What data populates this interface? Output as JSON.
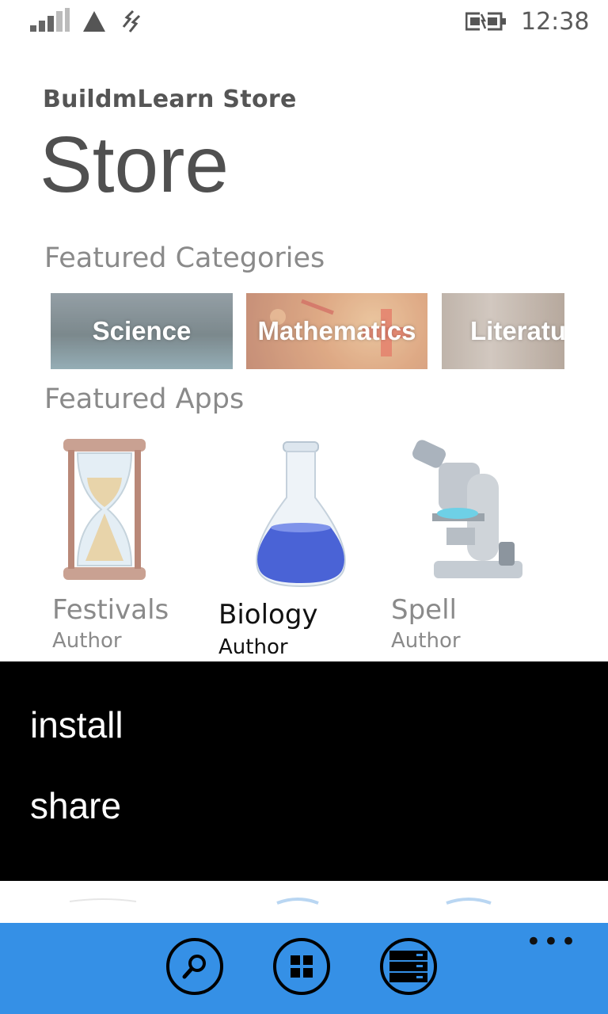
{
  "status_bar": {
    "time": "12:38",
    "icons": [
      "signal-icon",
      "warning-triangle-icon",
      "data-connection-icon",
      "battery-charging-icon"
    ]
  },
  "header": {
    "app_title": "BuildmLearn Store",
    "page_title": "Store"
  },
  "featured_categories": {
    "title": "Featured Categories",
    "items": [
      {
        "label": "Science"
      },
      {
        "label": "Mathematics"
      },
      {
        "label": "Literatu"
      }
    ]
  },
  "featured_apps": {
    "title": "Featured Apps",
    "items": [
      {
        "name": "Festivals",
        "author": "Author",
        "icon": "hourglass-icon"
      },
      {
        "name": "Biology",
        "author": "Author",
        "icon": "flask-icon"
      },
      {
        "name": "Spell",
        "author": "Author",
        "icon": "microscope-icon"
      }
    ]
  },
  "context_menu": {
    "items": [
      {
        "label": "install"
      },
      {
        "label": "share"
      }
    ]
  },
  "app_bar": {
    "buttons": [
      "search-icon",
      "categories-icon",
      "list-icon"
    ],
    "more_label": "•••",
    "color": "#3590e6"
  }
}
